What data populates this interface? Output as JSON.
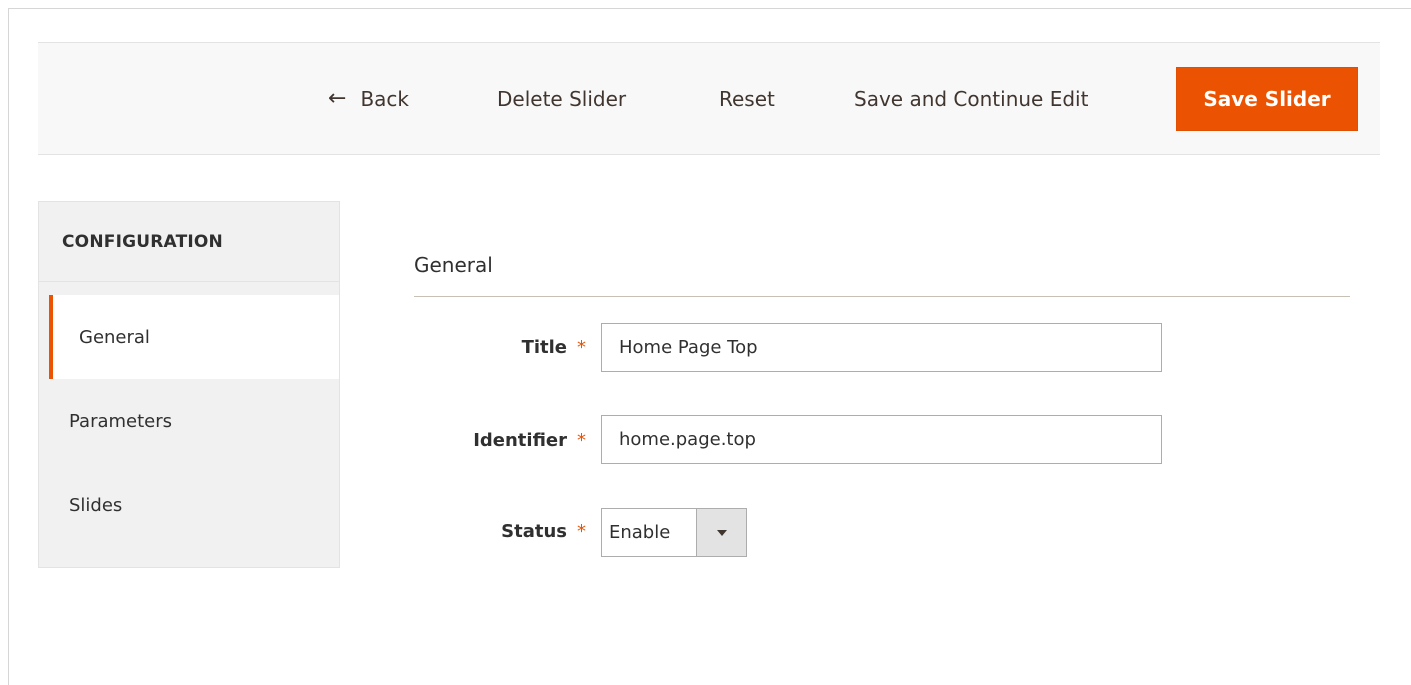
{
  "toolbar": {
    "back_label": "Back",
    "delete_label": "Delete Slider",
    "reset_label": "Reset",
    "save_continue_label": "Save and Continue Edit",
    "save_label": "Save Slider",
    "back_icon": "arrow-left-icon"
  },
  "sidenav": {
    "title": "CONFIGURATION",
    "items": [
      {
        "label": "General",
        "active": true
      },
      {
        "label": "Parameters",
        "active": false
      },
      {
        "label": "Slides",
        "active": false
      }
    ]
  },
  "form": {
    "section_title": "General",
    "required_mark": "*",
    "title": {
      "label": "Title",
      "value": "Home Page Top"
    },
    "identifier": {
      "label": "Identifier",
      "value": "home.page.top"
    },
    "status": {
      "label": "Status",
      "value": "Enable",
      "icon": "caret-down-icon"
    }
  },
  "colors": {
    "accent": "#eb5202",
    "toolbar_bg": "#f8f8f8",
    "sidenav_bg": "#f1f1f1"
  }
}
